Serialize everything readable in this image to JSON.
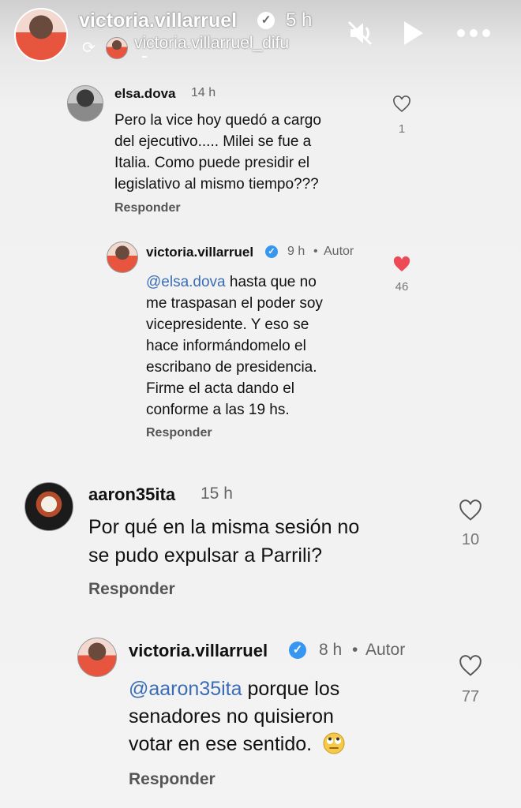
{
  "story": {
    "username": "victoria.villarruel",
    "time": "5 h",
    "repost_username": "victoria.villarruel_difu",
    "icons": [
      "volume-off-icon",
      "play-icon",
      "more-icon"
    ]
  },
  "comments": [
    {
      "username": "elsa.dova",
      "time": "14 h",
      "text_lines": [
        "Pero la vice hoy  quedó a cargo",
        "del ejecutivo..... Milei se fue a",
        "Italia. Como puede presidir el",
        "legislativo al mismo tiempo???"
      ],
      "reply_label": "Responder",
      "likes": "1",
      "liked": false
    },
    {
      "username": "victoria.villarruel",
      "time": "9 h",
      "author_tag": "Autor",
      "mention": "@elsa.dova",
      "text_lines": [
        "hasta que no",
        "me traspasan el poder soy",
        "vicepresidente. Y eso se",
        "hace informándomelo el",
        "escribano de presidencia.",
        "Firme el acta dando el",
        "conforme a las 19 hs."
      ],
      "reply_label": "Responder",
      "likes": "46",
      "liked": true,
      "like_color": "#ed4956"
    },
    {
      "username": "aaron35ita",
      "time": "15 h",
      "text_lines": [
        "Por qué en la misma sesión no",
        "se pudo expulsar a Parrili?"
      ],
      "reply_label": "Responder",
      "likes": "10",
      "liked": false
    },
    {
      "username": "victoria.villarruel",
      "time": "8 h",
      "author_tag": "Autor",
      "mention": "@aaron35ita",
      "text_lines": [
        "porque los",
        "senadores no quisieron",
        "votar en ese sentido."
      ],
      "emoji": "eye-roll-emoji",
      "reply_label": "Responder",
      "likes": "77",
      "liked": false
    }
  ],
  "colors": {
    "link": "#3b6db6",
    "verified": "#3797f0",
    "heart_liked": "#ed4956"
  }
}
